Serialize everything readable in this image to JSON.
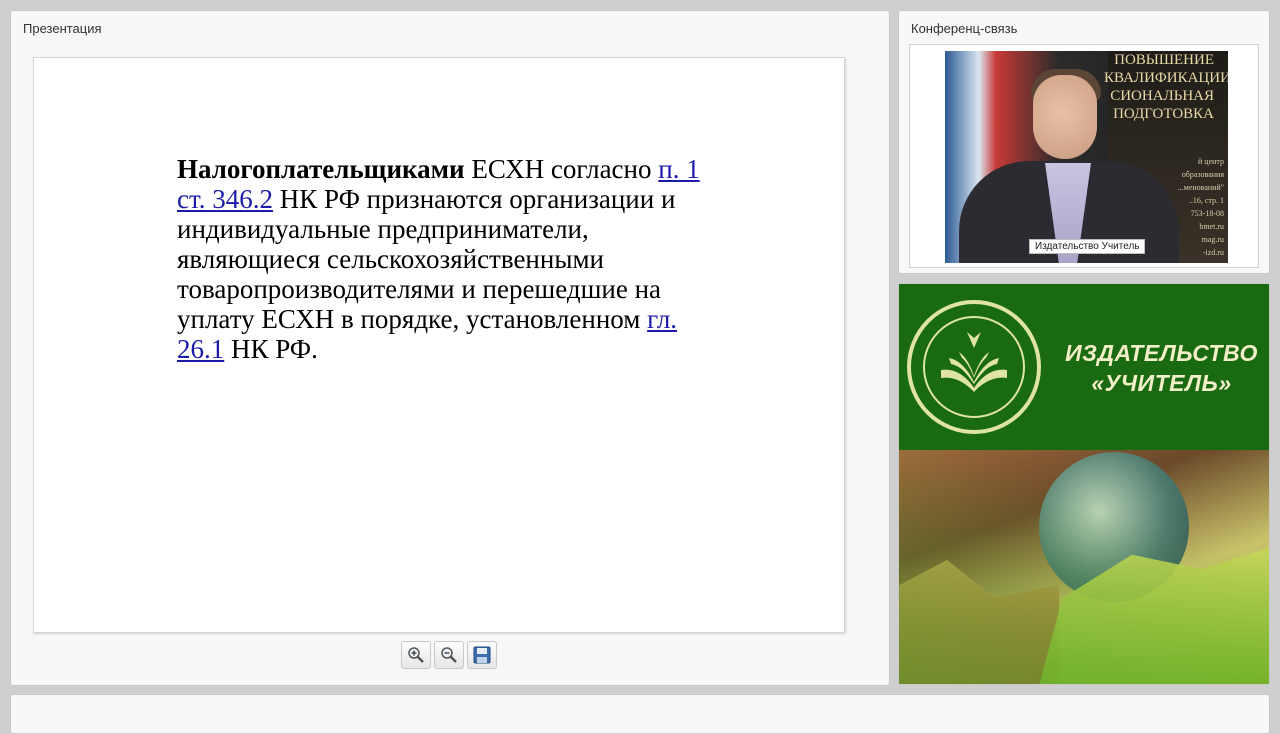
{
  "presentation": {
    "title": "Презентация",
    "slide": {
      "bold_term": "Налогоплательщиками",
      "part1": " ЕСХН согласно ",
      "link1": "п. 1 ст. 346.2",
      "part2": " НК РФ признаются организации и индивидуальные предприниматели, являющиеся сельскохозяйственными товаропроизводителями и перешедшие на уплату ЕСХН в порядке, установленном ",
      "link2": "гл. 26.1",
      "part3": " НК РФ."
    },
    "toolbar": {
      "zoom_in_icon": "zoom-in-icon",
      "zoom_out_icon": "zoom-out-icon",
      "save_icon": "save-icon"
    }
  },
  "conference": {
    "title": "Конференц-связь",
    "video_label": "Издательство Учитель",
    "background_text": [
      "ПОВЫШЕНИЕ",
      "КВАЛИФИКАЦИИ",
      "СИОНАЛЬНАЯ",
      "ПОДГОТОВКА"
    ],
    "background_small": [
      "й центр образования",
      "...менований\"",
      "..16, стр. 1",
      "753-18-08",
      "bmet.ru",
      "mag.ru",
      "-izd.ru"
    ]
  },
  "brand": {
    "line1": "ИЗДАТЕЛЬСТВО",
    "line2": "«УЧИТЕЛЬ»",
    "colors": {
      "green": "#1a6a12",
      "cream": "#f3efc8"
    }
  }
}
